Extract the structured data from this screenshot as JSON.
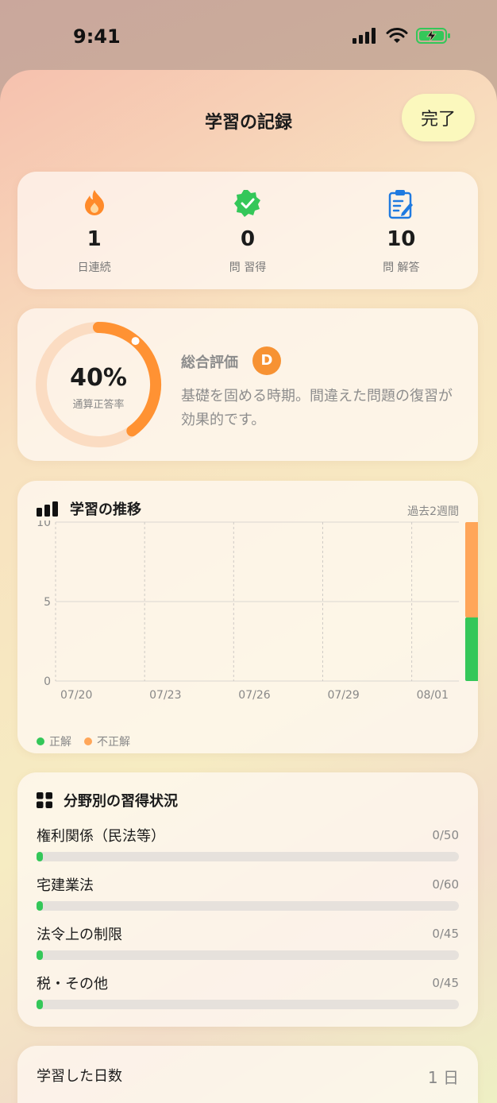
{
  "status": {
    "time": "9:41"
  },
  "header": {
    "title": "学習の記録",
    "done_label": "完了"
  },
  "stats": [
    {
      "icon": "flame-icon",
      "value": "1",
      "label": "日連続"
    },
    {
      "icon": "verified-badge-icon",
      "value": "0",
      "label": "問 習得"
    },
    {
      "icon": "clipboard-edit-icon",
      "value": "10",
      "label": "問 解答"
    }
  ],
  "summary": {
    "percent_text": "40%",
    "percent": 40,
    "percent_label": "通算正答率",
    "eval_title": "総合評価",
    "grade": "D",
    "advice": "基礎を固める時期。間違えた問題の復習が効果的です。"
  },
  "trend": {
    "title": "学習の推移",
    "period": "過去2週間",
    "legend": {
      "correct": "正解",
      "incorrect": "不正解"
    }
  },
  "chart_data": {
    "type": "bar",
    "stacked": true,
    "title": "学習の推移",
    "x_tick_labels": [
      "07/20",
      "07/23",
      "07/26",
      "07/29",
      "08/01"
    ],
    "y_ticks": [
      0,
      5,
      10
    ],
    "ylim": [
      0,
      10
    ],
    "series": [
      {
        "name": "正解",
        "color": "#34c759",
        "data": [
          {
            "x": "08/02",
            "y": 4
          }
        ]
      },
      {
        "name": "不正解",
        "color": "#ffa659",
        "data": [
          {
            "x": "08/02",
            "y": 6
          }
        ]
      }
    ],
    "grid": true,
    "legend_position": "bottom-left"
  },
  "fields": {
    "title": "分野別の習得状況",
    "items": [
      {
        "name": "権利関係（民法等）",
        "count": "0/50",
        "progress": 0
      },
      {
        "name": "宅建業法",
        "count": "0/60",
        "progress": 0
      },
      {
        "name": "法令上の制限",
        "count": "0/45",
        "progress": 0
      },
      {
        "name": "税・その他",
        "count": "0/45",
        "progress": 0
      }
    ]
  },
  "days": {
    "label": "学習した日数",
    "value": "1 日"
  },
  "colors": {
    "accent": "#f79233",
    "correct": "#34c759",
    "incorrect": "#ffa659"
  }
}
